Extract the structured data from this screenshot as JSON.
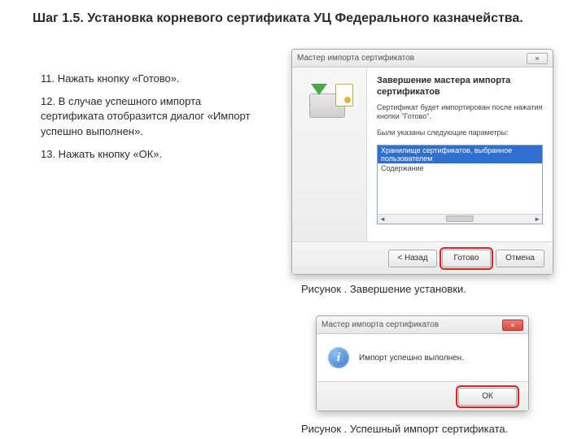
{
  "heading": "Шаг 1.5. Установка корневого сертификата УЦ Федерального казначейства.",
  "instructions": {
    "step11": "11. Нажать кнопку «Готово».",
    "step12": "12. В случае успешного импорта сертификата отобразится диалог «Импорт успешно выполнен».",
    "step13": "13. Нажать кнопку «ОК»."
  },
  "wizard": {
    "title": "Мастер импорта сертификатов",
    "heading": "Завершение мастера импорта сертификатов",
    "desc": "Сертификат будет импортирован после нажатия кнопки \"Готово\".",
    "params_label": "Были указаны следующие параметры:",
    "list_selected": "Хранилище сертификатов, выбранное пользователем",
    "list_row2": "Содержание",
    "back": "< Назад",
    "finish": "Готово",
    "cancel": "Отмена",
    "close_x": "×"
  },
  "caption1": "Рисунок . Завершение установки.",
  "dialog": {
    "title": "Мастер импорта сертификатов",
    "message": "Импорт успешно выполнен.",
    "ok": "ОК",
    "close_x": "×",
    "info_glyph": "i"
  },
  "caption2": "Рисунок . Успешный импорт сертификата."
}
